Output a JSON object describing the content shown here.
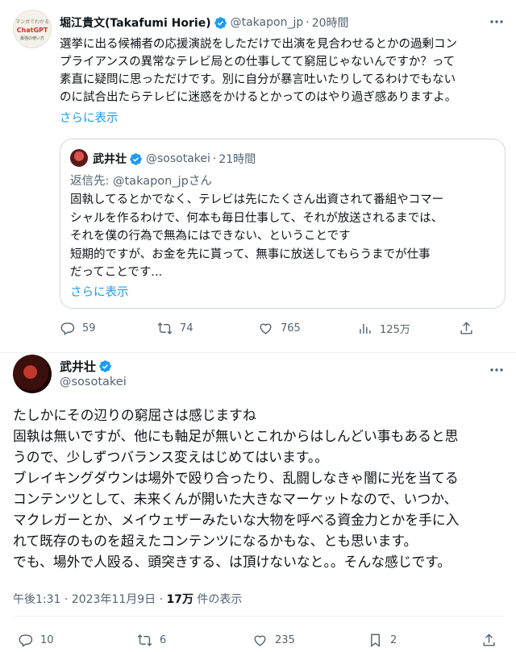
{
  "tweet1": {
    "author_name": "堀江貴文(Takafumi Horie)",
    "handle": "@takapon_jp",
    "time": "20時間",
    "avatar_text": {
      "top": "マンガでわかる",
      "main": "ChatGPT",
      "sub": "最強の使い方"
    },
    "body_lines": [
      "選挙に出る候補者の応援演説をしただけで出演を見合わせるとかの過剰コン",
      "プライアンスの異常なテレビ局との仕事してて窮屈じゃないんですか？って",
      "素直に疑問に思っただけです。別に自分が暴言吐いたりしてるわけでもない",
      "のに試合出たらテレビに迷惑をかけるとかってのはやり過ぎ感ありますよ。"
    ],
    "show_more": "さらに表示",
    "quote": {
      "author_name": "武井壮",
      "handle": "@sosotakei",
      "time": "21時間",
      "reply_to": "返信先: @takapon_jpさん",
      "body_lines": [
        "固執してるとかでなく、テレビは先にたくさん出資されて番組やコマー",
        "シャルを作るわけで、何本も毎日仕事して、それが放送されるまでは、",
        "それを僕の行為で無為にはできない、ということです",
        "短期的ですが、お金を先に貰って、無事に放送してもらうまでが仕事",
        "だってことです..."
      ],
      "show_more": "さらに表示"
    },
    "actions": {
      "replies": "59",
      "retweets": "74",
      "likes": "765",
      "views": "125万"
    }
  },
  "tweet2": {
    "author_name": "武井壮",
    "handle": "@sosotakei",
    "body_lines": [
      "たしかにその辺りの窮屈さは感じますね",
      "固執は無いですが、他にも軸足が無いとこれからはしんどい事もあると思",
      "うので、少しずつバランス変えはじめてはいます。。",
      "ブレイキングダウンは場外で殴り合ったり、乱闘しなきゃ闇に光を当てる",
      "コンテンツとして、未来くんが開いた大きなマーケットなので、いつか、",
      "マクレガーとか、メイウェザーみたいな大物を呼べる資金力とかを手に入",
      "れて既存のものを超えたコンテンツになるかもな、とも思います。",
      "でも、場外で人殴る、頭突きする、は頂けないなと。。そんな感じです。"
    ],
    "meta": {
      "time": "午後1:31 · 2023年11月9日 · ",
      "views_count": "17万",
      "views_label": " 件の表示"
    },
    "actions": {
      "replies": "10",
      "retweets": "6",
      "likes": "235",
      "bookmarks": "2"
    }
  },
  "colors": {
    "accent": "#1d9bf0",
    "text": "#0f1419",
    "secondary": "#536471",
    "border": "#cfd9de"
  }
}
